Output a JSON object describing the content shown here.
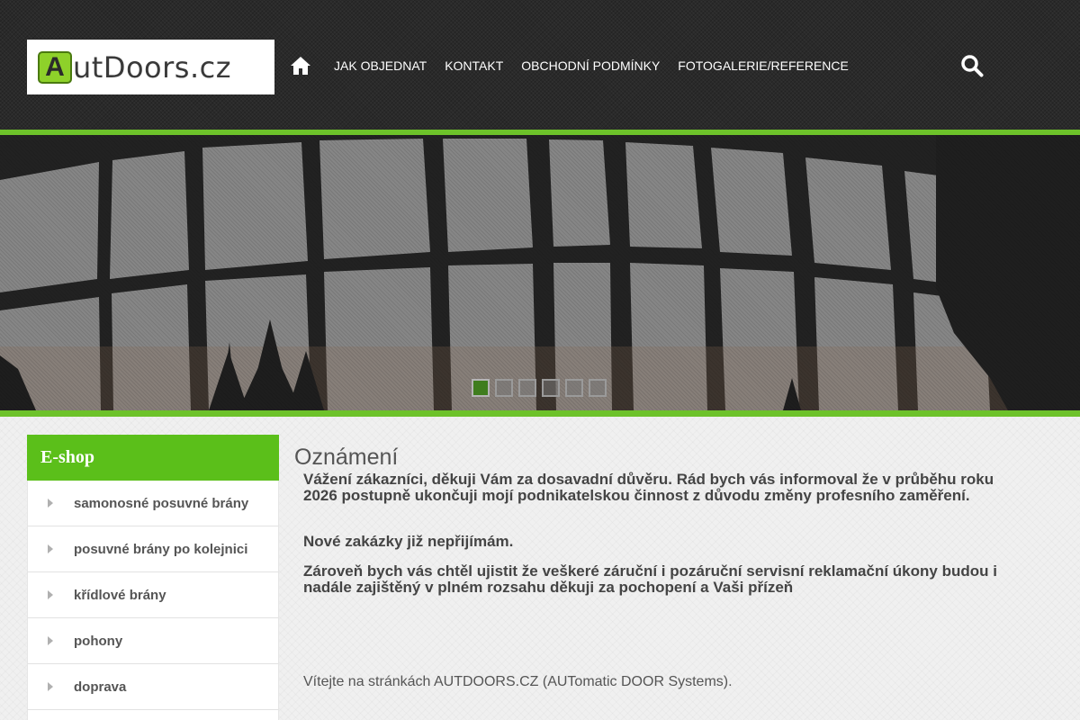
{
  "header": {
    "logo_letter": "A",
    "logo_text": "utDoors.cz",
    "nav": [
      {
        "label": "JAK OBJEDNAT"
      },
      {
        "label": "KONTAKT"
      },
      {
        "label": "OBCHODNÍ PODMÍNKY"
      },
      {
        "label": "FOTOGALERIE/REFERENCE"
      }
    ],
    "icons": {
      "home": "home-icon",
      "search": "search-icon"
    }
  },
  "slider": {
    "slide_count": 6,
    "active_slide": 1,
    "active_color": "#3f7d1e",
    "accent_color": "#6dc22a"
  },
  "sidebar": {
    "title": "E-shop",
    "title_color": "#5bbf1a",
    "items": [
      {
        "label": "samonosné posuvné brány"
      },
      {
        "label": "posuvné brány po kolejnici"
      },
      {
        "label": "křídlové brány"
      },
      {
        "label": "pohony"
      },
      {
        "label": "doprava"
      }
    ]
  },
  "main": {
    "title": "Oznámení",
    "paragraphs": [
      "Vážení zákazníci, děkuji Vám za dosavadní důvěru. Rád bych vás informoval že v průběhu roku 2026 postupně ukončuji mojí podnikatelskou činnost z důvodu změny profesního zaměření.",
      "Nové zakázky již nepřijímám.",
      "Zároveň bych vás chtěl ujistit že veškeré záruční i pozáruční servisní reklamační úkony budou i nadále zajištěný v plném rozsahu děkuji za pochopení a Vaši přízeň"
    ],
    "welcome": "Vítejte na stránkách AUTDOORS.CZ (AUTomatic DOOR Systems)."
  }
}
